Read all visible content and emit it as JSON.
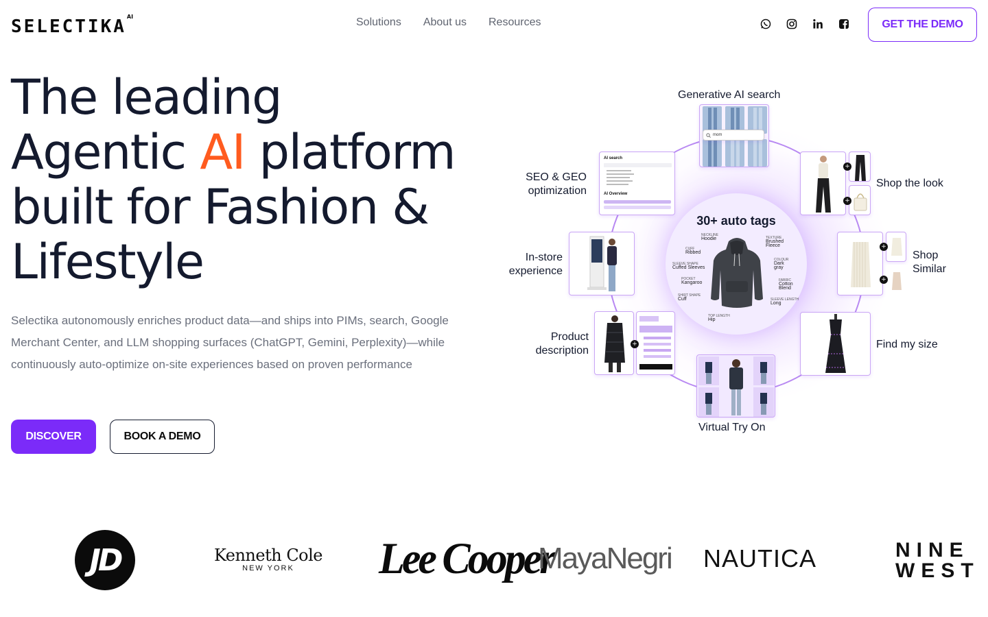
{
  "header": {
    "logo_text": "SELECTIKA",
    "logo_sup": "AI",
    "nav": [
      {
        "label": "Solutions"
      },
      {
        "label": "About us"
      },
      {
        "label": "Resources"
      }
    ],
    "socials": [
      "whatsapp-icon",
      "instagram-icon",
      "linkedin-icon",
      "facebook-icon"
    ],
    "cta_label": "GET THE DEMO"
  },
  "hero": {
    "title_line1": "The leading",
    "title_line2_pre": "Agentic ",
    "title_line2_accent": "AI",
    "title_line2_post": " platform",
    "title_line3": "built for Fashion &",
    "title_line4": "Lifestyle",
    "subtitle": "Selectika autonomously enriches product data—and ships into PIMs, search, Google Merchant Center, and LLM shopping surfaces (ChatGPT, Gemini, Perplexity)—while continuously auto-optimize on-site experiences based on proven performance",
    "discover_label": "DISCOVER",
    "book_label": "BOOK A DEMO"
  },
  "diagram": {
    "hub_title": "30+ auto tags",
    "tags": [
      {
        "k": "NECKLINE",
        "v": "Hoodie"
      },
      {
        "k": "CUFF",
        "v": "Ribbed"
      },
      {
        "k": "SLEEVE SHAPE",
        "v": "Cuffed Sleeves"
      },
      {
        "k": "POCKET",
        "v": "Kangaroo"
      },
      {
        "k": "SHIRT SHAPE",
        "v": "Cuff"
      },
      {
        "k": "TOP LENGTH",
        "v": "Hip"
      },
      {
        "k": "TEXTURE",
        "v": "Brushed Fleece"
      },
      {
        "k": "COLOUR",
        "v": "Dark gray"
      },
      {
        "k": "FABRIC",
        "v": "Cotton Blend"
      },
      {
        "k": "SLEEVE LENGTH",
        "v": "Long"
      }
    ],
    "search_text": "mom",
    "ai_search_label": "AI search",
    "ai_overview_label": "AI Overview",
    "labels": {
      "gen_ai": "Generative AI search",
      "seo": "SEO & GEO optimization",
      "shop_look": "Shop the look",
      "instore": "In-store experience",
      "shop_similar": "Shop Similar",
      "product_desc": "Product description",
      "find_size": "Find my size",
      "try_on": "Virtual Try On"
    },
    "accent_color": "#7b2bf9",
    "ring_color": "#b889f2"
  },
  "brands": [
    {
      "name": "JD"
    },
    {
      "name": "Kenneth Cole",
      "sub": "NEW YORK"
    },
    {
      "name": "Lee Cooper"
    },
    {
      "name": "MayaNegri"
    },
    {
      "name": "NAUTICA"
    },
    {
      "name": "NINE",
      "name2": "WEST"
    }
  ],
  "colors": {
    "accent": "#7b2bf9",
    "highlight": "#ff5b1f",
    "ink": "#141a2e"
  }
}
